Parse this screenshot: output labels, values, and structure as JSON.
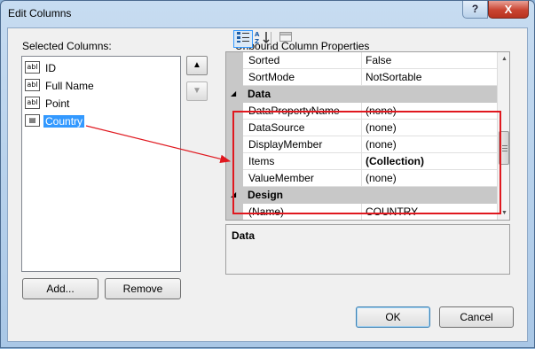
{
  "window": {
    "title": "Edit Columns",
    "help_label": "?",
    "close_label": "X"
  },
  "left": {
    "label": "Selected Columns:",
    "columns": [
      {
        "label": "ID",
        "icon": "textbox-column-icon",
        "icon_text": "abl",
        "selected": false
      },
      {
        "label": "Full Name",
        "icon": "textbox-column-icon",
        "icon_text": "abl",
        "selected": false
      },
      {
        "label": "Point",
        "icon": "textbox-column-icon",
        "icon_text": "abl",
        "selected": false
      },
      {
        "label": "Country",
        "icon": "combobox-column-icon",
        "icon_text": "▤",
        "selected": true
      }
    ],
    "move_up_glyph": "▲",
    "move_down_glyph": "▼",
    "add_label": "Add...",
    "remove_label": "Remove"
  },
  "right": {
    "label": "Unbound Column Properties",
    "toolbar": {
      "categorized_icon": "categorized-icon",
      "alphabetical_icon": "alphabetical-icon",
      "property_pages_icon": "property-pages-icon"
    },
    "rows": [
      {
        "type": "prop",
        "name": "Sorted",
        "value": "False"
      },
      {
        "type": "prop",
        "name": "SortMode",
        "value": "NotSortable"
      },
      {
        "type": "cat",
        "name": "Data"
      },
      {
        "type": "prop",
        "name": "DataPropertyName",
        "value": "(none)"
      },
      {
        "type": "prop",
        "name": "DataSource",
        "value": "(none)"
      },
      {
        "type": "prop",
        "name": "DisplayMember",
        "value": "(none)"
      },
      {
        "type": "prop",
        "name": "Items",
        "value": "(Collection)",
        "bold": true
      },
      {
        "type": "prop",
        "name": "ValueMember",
        "value": "(none)"
      },
      {
        "type": "cat",
        "name": "Design"
      },
      {
        "type": "prop",
        "name": "(Name)",
        "value": "COUNTRY"
      }
    ],
    "category_caret": "◢",
    "description_title": "Data"
  },
  "footer": {
    "ok_label": "OK",
    "cancel_label": "Cancel"
  },
  "colors": {
    "highlight": "#e0181f",
    "selection": "#3399ff"
  }
}
